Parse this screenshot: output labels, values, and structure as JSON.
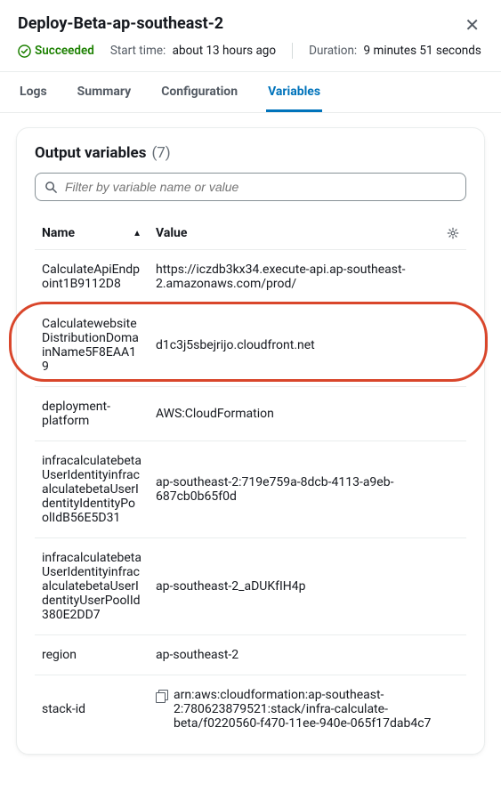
{
  "header": {
    "title": "Deploy-Beta-ap-southeast-2",
    "status": "Succeeded",
    "start_label": "Start time:",
    "start_value": "about 13 hours ago",
    "duration_label": "Duration:",
    "duration_value": "9 minutes 51 seconds"
  },
  "tabs": [
    "Logs",
    "Summary",
    "Configuration",
    "Variables"
  ],
  "card": {
    "title": "Output variables",
    "count": "(7)",
    "filter_placeholder": "Filter by variable name or value",
    "columns": {
      "name": "Name",
      "value": "Value"
    },
    "rows": [
      {
        "name": "CalculateApiEndpoint1B9112D8",
        "value": "https://iczdb3kx34.execute-api.ap-southeast-2.amazonaws.com/prod/",
        "copy": false
      },
      {
        "name": "CalculatewebsiteDistributionDomainName5F8EAA19",
        "value": "d1c3j5sbejrijo.cloudfront.net",
        "copy": false
      },
      {
        "name": "deployment-platform",
        "value": "AWS:CloudFormation",
        "copy": false
      },
      {
        "name": "infracalculatebetaUserIdentityinfracalculatebetaUserIdentityIdentityPoolIdB56E5D31",
        "value": "ap-southeast-2:719e759a-8dcb-4113-a9eb-687cb0b65f0d",
        "copy": false
      },
      {
        "name": "infracalculatebetaUserIdentityinfracalculatebetaUserIdentityUserPoolId380E2DD7",
        "value": "ap-southeast-2_aDUKfIH4p",
        "copy": false
      },
      {
        "name": "region",
        "value": "ap-southeast-2",
        "copy": false
      },
      {
        "name": "stack-id",
        "value": "arn:aws:cloudformation:ap-southeast-2:780623879521:stack/infra-calculate-beta/f0220560-f470-11ee-940e-065f17dab4c7",
        "copy": true
      }
    ]
  }
}
